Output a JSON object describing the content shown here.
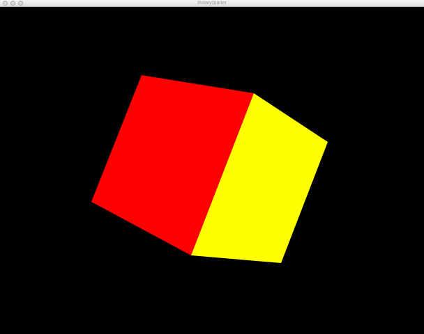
{
  "window": {
    "title": "RotaryStarter"
  },
  "scene": {
    "background": "#000000",
    "faces": [
      {
        "name": "front-face",
        "color": "#ff0000"
      },
      {
        "name": "right-face",
        "color": "#ffff00"
      }
    ]
  }
}
